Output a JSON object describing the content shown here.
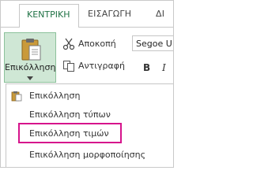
{
  "tabs": {
    "active": "ΚΕΝΤΡΙΚΗ",
    "next": "ΕΙΣΑΓΩΓΗ",
    "partial": "ΔΙ"
  },
  "ribbon": {
    "paste_label": "Επικόλληση",
    "cut_label": "Αποκοπή",
    "copy_label": "Αντιγραφή",
    "font_name": "Segoe U",
    "bold_label": "B",
    "italic_label": "I"
  },
  "menu": {
    "items": [
      {
        "label": "Επικόλληση"
      },
      {
        "label": "Επικόλληση τύπων"
      },
      {
        "label": "Επικόλληση τιμών"
      },
      {
        "label": "Επικόλληση μορφοποίησης"
      }
    ],
    "highlighted_index": 2
  },
  "colors": {
    "accent": "#217346",
    "paste_button_bg": "#cfe7d5",
    "highlight_border": "#d6148c"
  }
}
